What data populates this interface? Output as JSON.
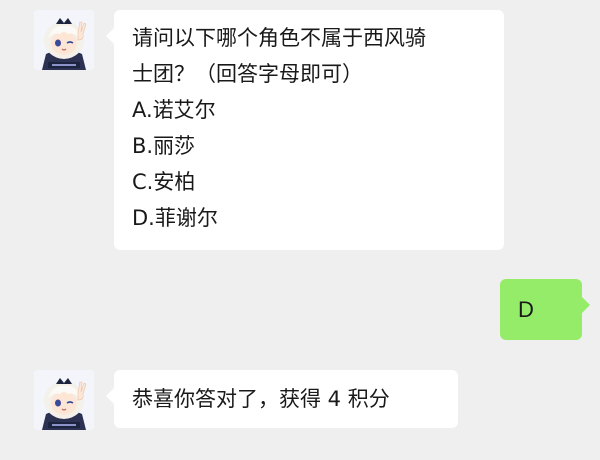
{
  "chat": {
    "messages": [
      {
        "sender": "left",
        "lines": [
          "请问以下哪个角色不属于西风骑",
          "士团？（回答字母即可）",
          "A.诺艾尔",
          "B.丽莎",
          "C.安柏",
          "D.菲谢尔"
        ]
      },
      {
        "sender": "right",
        "text": "D"
      },
      {
        "sender": "left",
        "text": "恭喜你答对了，获得 4 积分"
      }
    ],
    "avatar_icon": "paimon-avatar-icon",
    "colors": {
      "background": "#efefef",
      "bubble_left": "#ffffff",
      "bubble_right": "#95ec69",
      "text": "#191919"
    }
  }
}
